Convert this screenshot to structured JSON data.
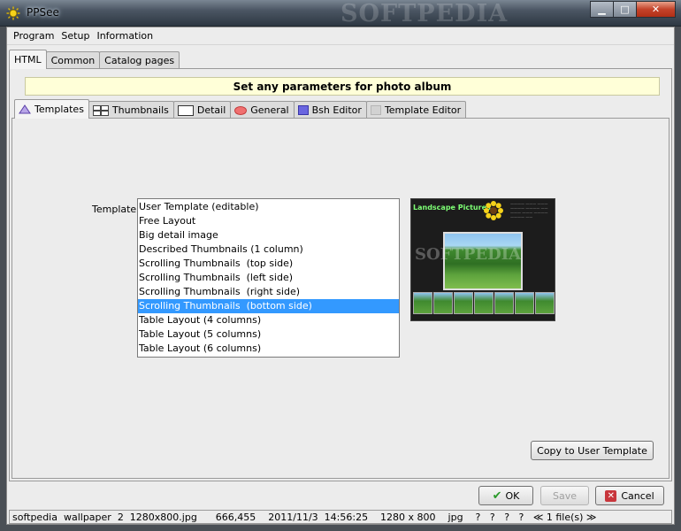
{
  "window": {
    "title": "PPSee",
    "watermark": "SOFTPEDIA"
  },
  "menu": [
    {
      "label": "Program"
    },
    {
      "label": "Setup"
    },
    {
      "label": "Information"
    }
  ],
  "top_tabs": [
    {
      "label": "HTML"
    },
    {
      "label": "Common"
    },
    {
      "label": "Catalog pages"
    }
  ],
  "banner": "Set any parameters for photo album",
  "sub_tabs": [
    {
      "label": "Templates"
    },
    {
      "label": "Thumbnails"
    },
    {
      "label": "Detail"
    },
    {
      "label": "General"
    },
    {
      "label": "Bsh Editor"
    },
    {
      "label": "Template Editor"
    }
  ],
  "template": {
    "label": "Template:",
    "items": [
      "User Template (editable)",
      "Free Layout",
      "Big detail image",
      "Described Thumbnails (1 column)",
      "Scrolling Thumbnails  (top side)",
      "Scrolling Thumbnails  (left side)",
      "Scrolling Thumbnails  (right side)",
      "Scrolling Thumbnails  (bottom side)",
      "Table Layout (4 columns)",
      "Table Layout (5 columns)",
      "Table Layout (6 columns)"
    ],
    "selected_index": 7
  },
  "preview": {
    "title": "Landscape Pictures",
    "watermark": "SOFTPEDIA"
  },
  "buttons": {
    "copy": "Copy to User Template",
    "ok": "OK",
    "save": "Save",
    "cancel": "Cancel"
  },
  "status": "softpedia  wallpaper  2  1280x800.jpg      666,455    2011/11/3  14:56:25    1280 x 800    jpg    ?   ?   ?   ?   ≪ 1 file(s) ≫",
  "colors": {
    "selection": "#3399ff",
    "banner_bg": "#ffffd8",
    "preview_title": "#7dff74"
  }
}
